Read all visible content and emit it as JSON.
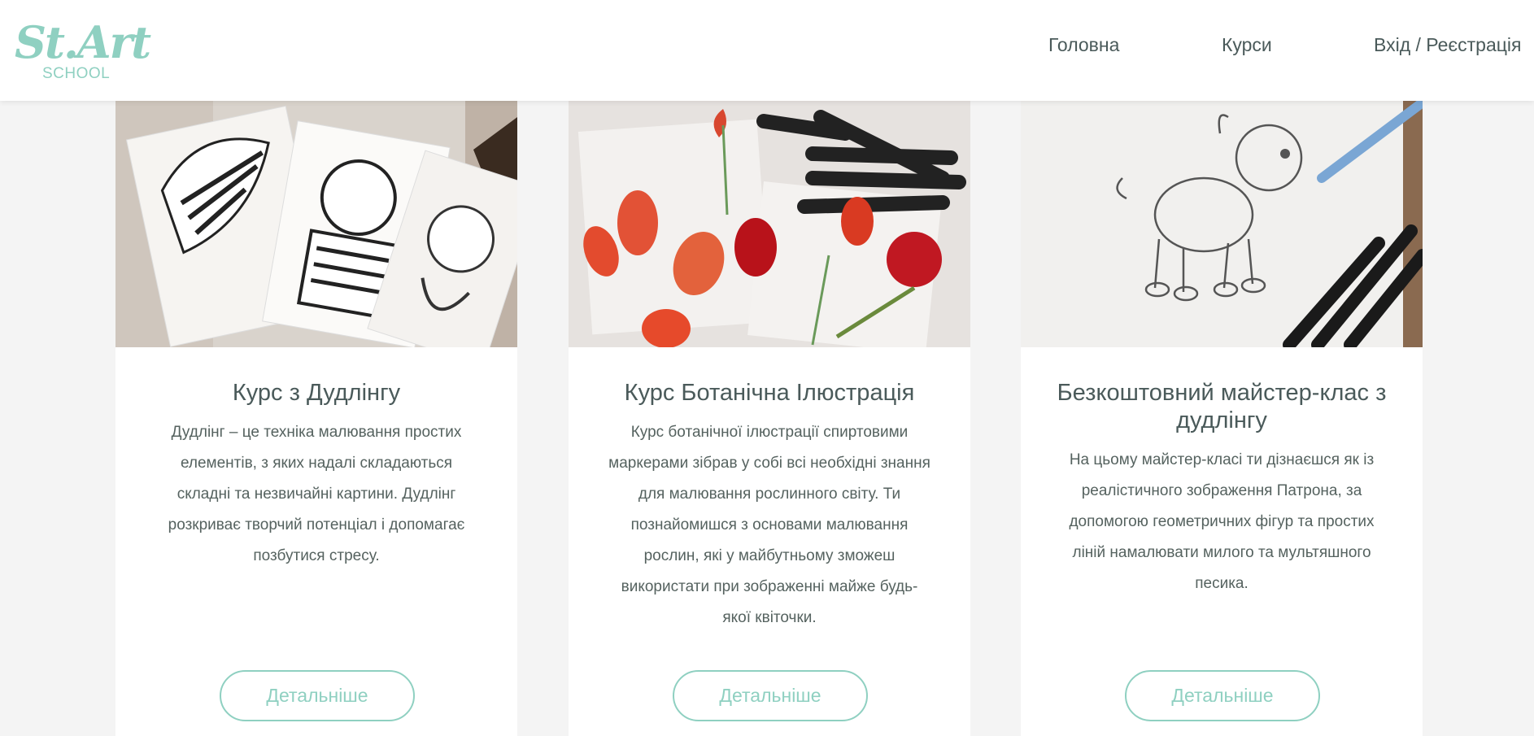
{
  "header": {
    "logo_text": "St.Art",
    "logo_sub": "SCHOOL",
    "nav": {
      "home": "Головна",
      "courses": "Курси",
      "login": "Вхід / Реєстрація"
    }
  },
  "courses": [
    {
      "title": "Курс з Дудлінгу",
      "description": "Дудлінг – це техніка малювання простих елементів, з яких надалі складаються складні та незвичайні картини. Дудлінг розкриває творчий потенціал і допомагає позбутися стресу.",
      "button": "Детальніше"
    },
    {
      "title": "Курс Ботанічна Ілюстрація",
      "description": "Курс ботанічної ілюстрації спиртовими маркерами зібрав у собі всі необхідні знання для малювання рослинного світу. Ти познайомишся з основами малювання рослин, які у майбутньому зможеш використати при зображенні майже будь-якої квіточки.",
      "button": "Детальніше"
    },
    {
      "title": "Безкоштовний майстер-клас з дудлінгу",
      "description": "На цьому майстер-класі ти дізнаєшся як із реалістичного зображення Патрона, за допомогою геометричних фігур та простих ліній намалювати милого та мультяшного песика.",
      "button": "Детальніше"
    }
  ],
  "colors": {
    "accent": "#8fd0c1",
    "text": "#4a5a5a",
    "background": "#f4f4f4",
    "card": "#ffffff"
  }
}
